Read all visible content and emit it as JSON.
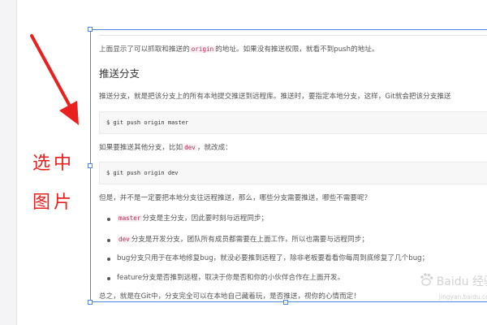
{
  "annotation": {
    "line1": "选中",
    "line2": "图片",
    "color": "#e8201e"
  },
  "selection": {
    "border_color": "#4a86e8"
  },
  "doc": {
    "intro": {
      "pre": "上面显示了可以抓取和推送的",
      "code": "origin",
      "post": "的地址。如果没有推送权限，就看不到push的地址。"
    },
    "heading": "推送分支",
    "para1": "推送分支，就是把该分支上的所有本地提交推送到远程库。推送时，要指定本地分支，这样，Git就会把该分支推送",
    "code1": "$ git push origin master",
    "para2": {
      "pre": "如果要推送其他分支，比如",
      "code": "dev",
      "post": "，就改成："
    },
    "code2": "$ git push origin dev",
    "para3": "但是，并不是一定要把本地分支往远程推送，那么，哪些分支需要推送，哪些不需要呢？",
    "bullets": [
      {
        "code": "master",
        "text": "分支是主分支，因此要时刻与远程同步；"
      },
      {
        "code": "dev",
        "text": "分支是开发分支，团队所有成员都需要在上面工作，所以也需要与远程同步；"
      },
      {
        "code": "",
        "text": "bug分支只用于在本地修复bug，就没必要推到远程了，除非老板要看看你每周到底修复了几个bug；"
      },
      {
        "code": "",
        "text": "feature分支是否推到远程，取决于你是否和你的小伙伴合作在上面开发。"
      }
    ],
    "summary": "总之，就是在Git中，分支完全可以在本地自己藏着玩，是否推送，视你的心情而定！"
  },
  "watermark": {
    "brand": "Baidu 经验",
    "url": "jingyan.baidu.com"
  }
}
